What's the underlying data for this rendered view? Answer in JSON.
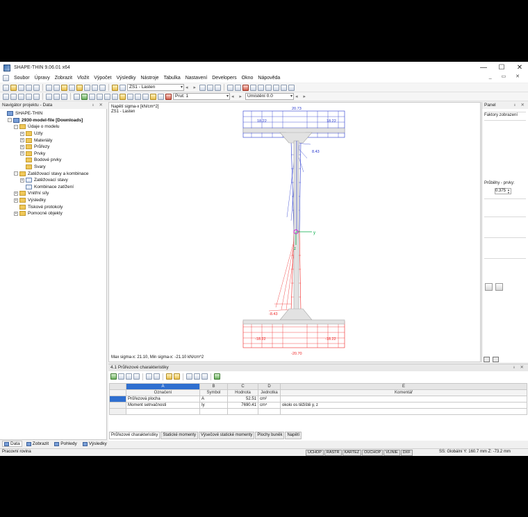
{
  "window": {
    "title": "SHAPE-THIN 9.06.01 x64",
    "controls": [
      "—",
      "☐",
      "✕"
    ]
  },
  "menu": [
    "Soubor",
    "Úpravy",
    "Zobrazit",
    "Vložit",
    "Výpočet",
    "Výsledky",
    "Nástroje",
    "Tabulka",
    "Nastavení",
    "Developers",
    "Okno",
    "Nápověda"
  ],
  "toolbar": {
    "loadcase": "ZS1 - Lasten",
    "member": "Prut: 1",
    "position": "Umístění 0.0"
  },
  "navigator": {
    "title": "Navigátor projektu - Data",
    "items": [
      {
        "label": "SHAPE-THIN",
        "level": 0,
        "icon": "root-icon",
        "exp": ""
      },
      {
        "label": "2930-model-file [Downloads]",
        "level": 1,
        "icon": "root-icon",
        "exp": "-",
        "bold": true
      },
      {
        "label": "Údaje o modelu",
        "level": 2,
        "icon": "folder-icon",
        "exp": "-"
      },
      {
        "label": "Uzly",
        "level": 3,
        "icon": "folder-icon",
        "exp": "+"
      },
      {
        "label": "Materiály",
        "level": 3,
        "icon": "folder-icon",
        "exp": "+"
      },
      {
        "label": "Průřezy",
        "level": 3,
        "icon": "folder-icon",
        "exp": "+"
      },
      {
        "label": "Prvky",
        "level": 3,
        "icon": "folder-icon",
        "exp": "+"
      },
      {
        "label": "Bodové prvky",
        "level": 3,
        "icon": "folder-icon",
        "exp": ""
      },
      {
        "label": "Svary",
        "level": 3,
        "icon": "folder-icon",
        "exp": ""
      },
      {
        "label": "Zatěžovací stavy a kombinace",
        "level": 2,
        "icon": "folder-icon",
        "exp": "-"
      },
      {
        "label": "Zatěžovací stavy",
        "level": 3,
        "icon": "file-icon",
        "exp": "+"
      },
      {
        "label": "Kombinace zatížení",
        "level": 3,
        "icon": "file-icon",
        "exp": ""
      },
      {
        "label": "Vnitřní síly",
        "level": 2,
        "icon": "folder-icon",
        "exp": "+"
      },
      {
        "label": "Výsledky",
        "level": 2,
        "icon": "folder-icon",
        "exp": "+"
      },
      {
        "label": "Tiskové protokoly",
        "level": 2,
        "icon": "folder-icon",
        "exp": ""
      },
      {
        "label": "Pomocné objekty",
        "level": 2,
        "icon": "folder-icon",
        "exp": "+"
      }
    ],
    "tabs": [
      "Data",
      "Zobrazit",
      "Pohledy",
      "Výsledky"
    ]
  },
  "canvas": {
    "caption_line1": "Napětí sigma-x [kN/cm^2]",
    "caption_line2": "ZS1 - Lasten",
    "footer": "Max sigma-x: 21.10, Min sigma-x: -21.10 kN/cm^2",
    "labels": {
      "top": "20.73",
      "top_left": "18.22",
      "top_right": "18.22",
      "web_top": "8.43",
      "web_bottom": "-8.43",
      "bot_left": "-18.22",
      "bot_right": "-18.22",
      "bottom": "-20.70",
      "axis_y": "y",
      "axis_z": "z"
    },
    "colors": {
      "positive": "#2233cc",
      "negative": "#ee2222",
      "section": "#a8a8a8",
      "axis": "#00aa44"
    }
  },
  "right_panel": {
    "title": "Panel",
    "label1": "Faktory zobrazení",
    "label2": "Průběhy - prvky:",
    "spin_value": "0.375"
  },
  "bottom_panel": {
    "title": "4.1 Průřezové charakteristiky",
    "col_letters": [
      "A",
      "B",
      "C",
      "D",
      "E"
    ],
    "col_names": [
      "Označení",
      "Symbol",
      "Hodnota",
      "Jednotka",
      "Komentář"
    ],
    "rows": [
      {
        "name": "Průřezová plocha",
        "symbol": "A",
        "value": "52.51",
        "unit": "cm²",
        "comment": ""
      },
      {
        "name": "Moment setrvačnosti",
        "symbol": "Iy",
        "value": "7690.41",
        "unit": "cm⁴",
        "comment": "okolo os těžiště y, z"
      }
    ],
    "tabs": [
      "Průřezové charakteristiky",
      "Statické momenty",
      "Výsečové statické momenty",
      "Plochy buněk",
      "Napětí"
    ]
  },
  "status": {
    "left": "Pracovní rovina",
    "buttons": [
      "UCHOP",
      "RASTR",
      "KARTEZ",
      "OUCHOP",
      "VLINIE",
      "DXF"
    ],
    "coords": "SS: Globální   Y: 160.7 mm   Z: -73.2 mm"
  }
}
